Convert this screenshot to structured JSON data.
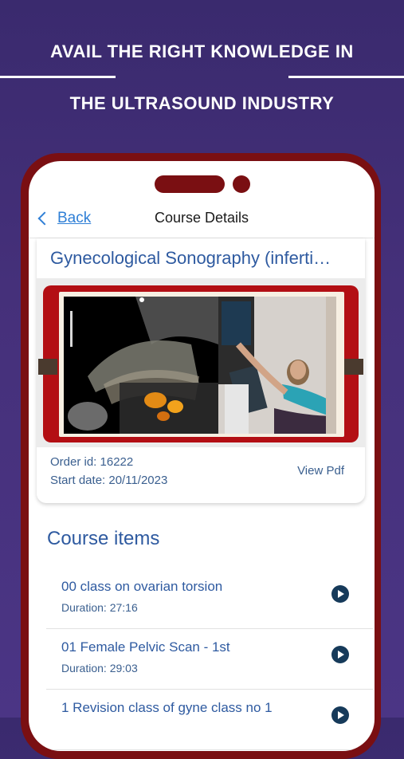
{
  "headline": {
    "line1": "AVAIL THE RIGHT KNOWLEDGE IN",
    "line2": "THE ULTRASOUND INDUSTRY"
  },
  "nav": {
    "back_label": "Back",
    "title": "Course Details"
  },
  "course": {
    "title": "Gynecological Sonography (inferti…",
    "order_id": "Order id: 16222",
    "start_date": "Start date: 20/11/2023",
    "view_pdf": "View Pdf"
  },
  "items_heading": "Course items",
  "items": [
    {
      "title": "00 class on ovarian torsion",
      "duration": "Duration: 27:16"
    },
    {
      "title": "01 Female Pelvic Scan - 1st",
      "duration": "Duration: 29:03"
    },
    {
      "title": "1 Revision class of gyne class no 1",
      "duration": ""
    }
  ],
  "colors": {
    "background": "#3f2d72",
    "phone_frame": "#7a0f12",
    "banner_red": "#b30f14",
    "link_blue": "#2f7fd6",
    "title_blue": "#2e5aa0",
    "play_icon": "#163a5a"
  }
}
